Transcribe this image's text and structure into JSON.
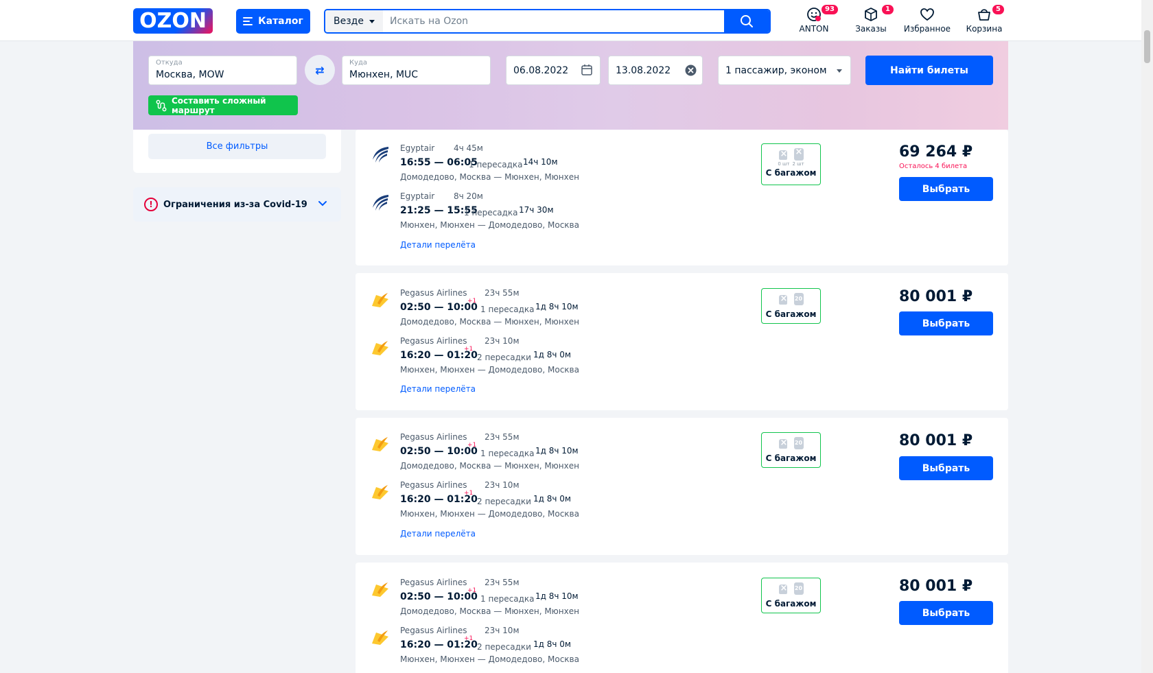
{
  "header": {
    "logo_text": "OZON",
    "catalog_label": "Каталог",
    "search_scope": "Везде",
    "search_placeholder": "Искать на Ozon",
    "user": {
      "label": "ANTON",
      "badge": "93"
    },
    "orders": {
      "label": "Заказы",
      "badge": "1"
    },
    "favorites": {
      "label": "Избранное"
    },
    "cart": {
      "label": "Корзина",
      "badge": "5"
    }
  },
  "search_form": {
    "from_label": "Откуда",
    "from_value": "Москва, MOW",
    "to_label": "Куда",
    "to_value": "Мюнхен, MUC",
    "date_out": "06.08.2022",
    "date_back": "13.08.2022",
    "passengers": "1 пассажир, эконом",
    "find_label": "Найти билеты",
    "route_label": "Составить сложный маршрут"
  },
  "sidebar": {
    "all_filters": "Все фильтры",
    "covid_label": "Ограничения из-за Covid-19"
  },
  "colors": {
    "brand": "#005bff",
    "accent_pink": "#f91155",
    "green": "#10c44c"
  },
  "results": [
    {
      "legs": [
        {
          "airline": "Egyptair",
          "flight_time": "4ч 45м",
          "times": "16:55 — 06:05",
          "plus_day": "",
          "stops": "1 пересадка",
          "total": "14ч 10м",
          "route": "Домодедово, Москва — Мюнхен, Мюнхен",
          "logo": "egyptair-logo-icon"
        },
        {
          "airline": "Egyptair",
          "flight_time": "8ч 20м",
          "times": "21:25 — 15:55",
          "plus_day": "",
          "stops": "1 пересадка",
          "total": "17ч 30м",
          "route": "Мюнхен, Мюнхен — Домодедово, Москва",
          "logo": "egyptair-logo-icon"
        }
      ],
      "details_label": "Детали перелёта",
      "baggage": {
        "label": "С багажом",
        "hand_count": "0 шт",
        "bag_count": "2 шт",
        "bag_weight": ""
      },
      "price": "69 264 ₽",
      "seats_left": "Осталось 4 билета",
      "select_label": "Выбрать"
    },
    {
      "legs": [
        {
          "airline": "Pegasus Airlines",
          "flight_time": "23ч 55м",
          "times": "02:50 — 10:00",
          "plus_day": "+1",
          "stops": "1 пересадка",
          "total": "1д 8ч 10м",
          "route": "Домодедово, Москва — Мюнхен, Мюнхен",
          "logo": "pegasus-logo-icon"
        },
        {
          "airline": "Pegasus Airlines",
          "flight_time": "23ч 10м",
          "times": "16:20 — 01:20",
          "plus_day": "+1",
          "stops": "2 пересадки",
          "total": "1д 8ч 0м",
          "route": "Мюнхен, Мюнхен — Домодедово, Москва",
          "logo": "pegasus-logo-icon"
        }
      ],
      "details_label": "Детали перелёта",
      "baggage": {
        "label": "С багажом",
        "hand_count": "",
        "bag_count": "",
        "bag_weight": "20"
      },
      "price": "80 001 ₽",
      "seats_left": "",
      "select_label": "Выбрать"
    },
    {
      "legs": [
        {
          "airline": "Pegasus Airlines",
          "flight_time": "23ч 55м",
          "times": "02:50 — 10:00",
          "plus_day": "+1",
          "stops": "1 пересадка",
          "total": "1д 8ч 10м",
          "route": "Домодедово, Москва — Мюнхен, Мюнхен",
          "logo": "pegasus-logo-icon"
        },
        {
          "airline": "Pegasus Airlines",
          "flight_time": "23ч 10м",
          "times": "16:20 — 01:20",
          "plus_day": "+1",
          "stops": "2 пересадки",
          "total": "1д 8ч 0м",
          "route": "Мюнхен, Мюнхен — Домодедово, Москва",
          "logo": "pegasus-logo-icon"
        }
      ],
      "details_label": "Детали перелёта",
      "baggage": {
        "label": "С багажом",
        "hand_count": "",
        "bag_count": "",
        "bag_weight": "20"
      },
      "price": "80 001 ₽",
      "seats_left": "",
      "select_label": "Выбрать"
    },
    {
      "legs": [
        {
          "airline": "Pegasus Airlines",
          "flight_time": "23ч 55м",
          "times": "02:50 — 10:00",
          "plus_day": "+1",
          "stops": "1 пересадка",
          "total": "1д 8ч 10м",
          "route": "Домодедово, Москва — Мюнхен, Мюнхен",
          "logo": "pegasus-logo-icon"
        },
        {
          "airline": "Pegasus Airlines",
          "flight_time": "23ч 10м",
          "times": "16:20 — 01:20",
          "plus_day": "+1",
          "stops": "2 пересадки",
          "total": "1д 8ч 0м",
          "route": "Мюнхен, Мюнхен — Домодедово, Москва",
          "logo": "pegasus-logo-icon"
        }
      ],
      "details_label": "",
      "baggage": {
        "label": "С багажом",
        "hand_count": "",
        "bag_count": "",
        "bag_weight": "20"
      },
      "price": "80 001 ₽",
      "seats_left": "",
      "select_label": "Выбрать"
    }
  ]
}
